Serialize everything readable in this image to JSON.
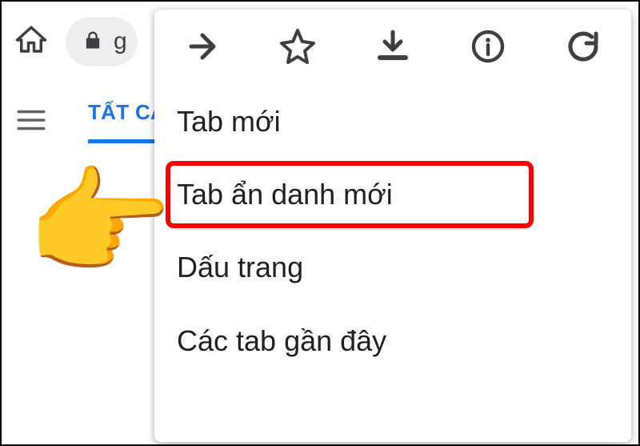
{
  "topbar": {
    "url_fragment": "g"
  },
  "secondary": {
    "active_tab_label": "TẤT CẢ"
  },
  "menu": {
    "items": [
      "Tab mới",
      "Tab ẩn danh mới",
      "Dấu trang",
      "Các tab gần đây"
    ],
    "highlighted_index": 1
  },
  "annotation": {
    "pointer_emoji": "👉"
  }
}
